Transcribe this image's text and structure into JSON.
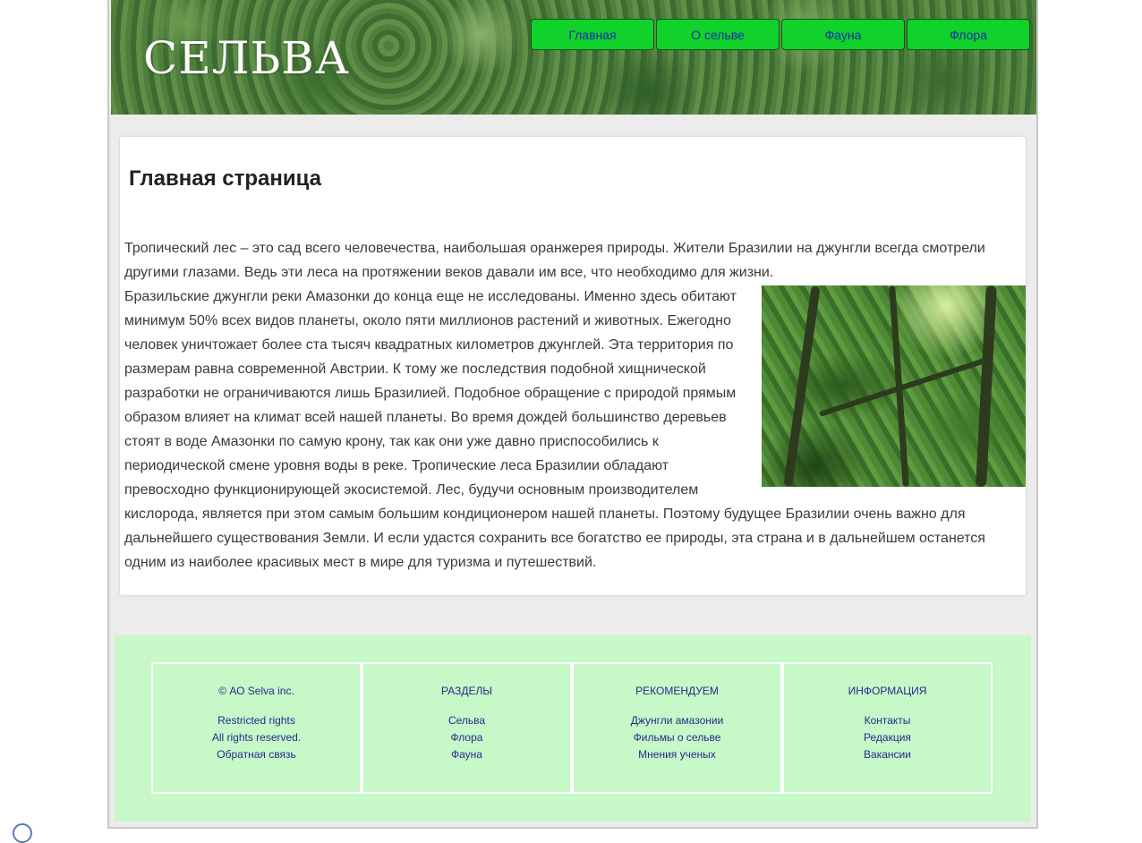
{
  "header": {
    "logo": "СЕЛЬВА",
    "nav": [
      {
        "label": "Главная"
      },
      {
        "label": "О сельве"
      },
      {
        "label": "Фауна"
      },
      {
        "label": "Флора"
      }
    ]
  },
  "main": {
    "title": "Главная страница",
    "paragraphs": [
      "Тропический лес – это сад всего человечества, наибольшая оранжерея природы. Жители Бразилии на джунгли всегда смотрели другими глазами. Ведь эти леса на протяжении веков давали им все, что необходимо для жизни.",
      "Бразильские джунгли реки Амазонки до конца еще не исследованы. Именно здесь обитают минимум 50% всех видов планеты, около пяти миллионов растений и животных. Ежегодно человек уничтожает более ста тысяч квадратных километров джунглей. Эта территория по размерам равна современной Австрии. К тому же последствия подобной хищнической разработки не ограничиваются лишь Бразилией. Подобное обращение с природой прямым образом влияет на климат всей нашей планеты. Во время дождей большинство деревьев стоят в воде Амазонки по самую крону, так как они уже давно приспособились к периодической смене уровня воды в реке. Тропические леса Бразилии обладают превосходно функционирующей экосистемой. Лес, будучи основным производителем кислорода, является при этом самым большим кондиционером нашей планеты. Поэтому будущее Бразилии очень важно для дальнейшего существования Земли. И если удастся сохранить все богатство ее природы, эта страна и в дальнейшем останется одним из наиболее красивых мест в мире для туризма и путешествий."
    ]
  },
  "footer": {
    "columns": [
      {
        "heading": "© АО Selva inc.",
        "links": [
          "Restricted rights",
          "All rights reserved.",
          "Обратная связь"
        ]
      },
      {
        "heading": "РАЗДЕЛЫ",
        "links": [
          "Сельва",
          "Флора",
          "Фауна"
        ]
      },
      {
        "heading": "РЕКОМЕНДУЕМ",
        "links": [
          "Джунгли амазонии",
          "Фильмы о сельве",
          "Мнения ученых"
        ]
      },
      {
        "heading": "ИНФОРМАЦИЯ",
        "links": [
          "Контакты",
          "Редакция",
          "Вакансии"
        ]
      }
    ]
  },
  "colors": {
    "nav_bg": "#10d22a",
    "nav_text": "#1a2bb0",
    "footer_bg": "#c6f8c8",
    "footer_text": "#2a2a8a",
    "page_bg": "#ececec"
  }
}
